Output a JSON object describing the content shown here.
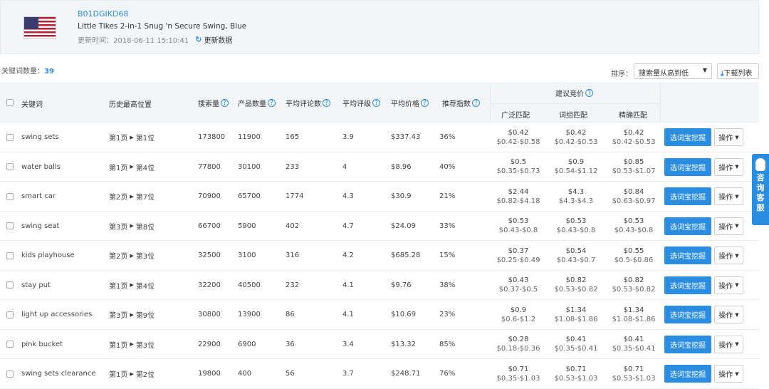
{
  "product": {
    "asin": "B01DGIKD68",
    "title": "Little Tikes 2-in-1 Snug 'n Secure Swing, Blue",
    "update_time": "更新时间：2018-06-11 15:10:41",
    "refresh_label": "更新数据"
  },
  "keyword_count": {
    "label": "关键词数量：",
    "value": "39"
  },
  "sort": {
    "label": "排序：",
    "selected": "搜索量从高到低"
  },
  "download_label": "下载列表",
  "columns": {
    "keyword": "关键词",
    "best_position": "历史最高位置",
    "search_volume": "搜索量",
    "product_count": "产品数量",
    "avg_reviews": "平均评论数",
    "avg_rating": "平均评级",
    "avg_price": "平均价格",
    "recommend": "推荐指数",
    "bid_group": "建议竞价",
    "broad": "广泛匹配",
    "phrase": "词组匹配",
    "exact": "精确匹配"
  },
  "rows": [
    {
      "keyword": "swing sets",
      "page": "第1页",
      "pos": "第1位",
      "search": "173800",
      "products": "11900",
      "reviews": "165",
      "rating": "3.9",
      "price": "$337.43",
      "rec": "36%",
      "broad": "$0.42",
      "broad_range": "$0.42-$0.58",
      "phrase": "$0.42",
      "phrase_range": "$0.42-$0.53",
      "exact": "$0.42",
      "exact_range": "$0.42-$0.53"
    },
    {
      "keyword": "water balls",
      "page": "第1页",
      "pos": "第4位",
      "search": "77800",
      "products": "30100",
      "reviews": "233",
      "rating": "4",
      "price": "$8.96",
      "rec": "40%",
      "broad": "$0.5",
      "broad_range": "$0.35-$0.73",
      "phrase": "$0.9",
      "phrase_range": "$0.54-$1.12",
      "exact": "$0.85",
      "exact_range": "$0.53-$1.07"
    },
    {
      "keyword": "smart car",
      "page": "第2页",
      "pos": "第7位",
      "search": "70900",
      "products": "65700",
      "reviews": "1774",
      "rating": "4.3",
      "price": "$30.9",
      "rec": "21%",
      "broad": "$2.44",
      "broad_range": "$0.82-$4.18",
      "phrase": "$4.3",
      "phrase_range": "$4.3-$4.3",
      "exact": "$0.84",
      "exact_range": "$0.63-$0.97"
    },
    {
      "keyword": "swing seat",
      "page": "第3页",
      "pos": "第8位",
      "search": "66700",
      "products": "5900",
      "reviews": "402",
      "rating": "4.7",
      "price": "$24.09",
      "rec": "33%",
      "broad": "$0.53",
      "broad_range": "$0.43-$0.8",
      "phrase": "$0.53",
      "phrase_range": "$0.43-$0.8",
      "exact": "$0.53",
      "exact_range": "$0.43-$0.8"
    },
    {
      "keyword": "kids playhouse",
      "page": "第2页",
      "pos": "第3位",
      "search": "32500",
      "products": "3100",
      "reviews": "316",
      "rating": "4.2",
      "price": "$685.28",
      "rec": "15%",
      "broad": "$0.37",
      "broad_range": "$0.25-$0.49",
      "phrase": "$0.54",
      "phrase_range": "$0.43-$0.7",
      "exact": "$0.55",
      "exact_range": "$0.5-$0.86"
    },
    {
      "keyword": "stay put",
      "page": "第1页",
      "pos": "第4位",
      "search": "32200",
      "products": "40500",
      "reviews": "232",
      "rating": "4.1",
      "price": "$9.76",
      "rec": "38%",
      "broad": "$0.43",
      "broad_range": "$0.37-$0.5",
      "phrase": "$0.82",
      "phrase_range": "$0.53-$0.82",
      "exact": "$0.82",
      "exact_range": "$0.53-$0.82"
    },
    {
      "keyword": "light up accessories",
      "page": "第3页",
      "pos": "第9位",
      "search": "30800",
      "products": "13900",
      "reviews": "86",
      "rating": "4.1",
      "price": "$10.69",
      "rec": "23%",
      "broad": "$0.9",
      "broad_range": "$0.6-$1.2",
      "phrase": "$1.34",
      "phrase_range": "$1.08-$1.86",
      "exact": "$1.34",
      "exact_range": "$1.08-$1.86"
    },
    {
      "keyword": "pink bucket",
      "page": "第1页",
      "pos": "第3位",
      "search": "22900",
      "products": "6900",
      "reviews": "36",
      "rating": "3.4",
      "price": "$13.32",
      "rec": "85%",
      "broad": "$0.28",
      "broad_range": "$0.18-$0.36",
      "phrase": "$0.41",
      "phrase_range": "$0.35-$0.41",
      "exact": "$0.41",
      "exact_range": "$0.35-$0.41"
    },
    {
      "keyword": "swing sets clearance",
      "page": "第1页",
      "pos": "第2位",
      "search": "19800",
      "products": "400",
      "reviews": "56",
      "rating": "3.7",
      "price": "$248.71",
      "rec": "76%",
      "broad": "$0.71",
      "broad_range": "$0.35-$1.03",
      "phrase": "$0.71",
      "phrase_range": "$0.53-$1.03",
      "exact": "$0.71",
      "exact_range": "$0.53-$1.03"
    }
  ],
  "row_actions": {
    "dig_label": "选词宝挖掘",
    "op_label": "操作"
  },
  "side_service": {
    "chars": [
      "咨",
      "询",
      "客",
      "服"
    ]
  },
  "colors": {
    "accent": "#2a8de0",
    "header_bg": "#f3f6f9"
  },
  "icons": {
    "refresh": "refresh-icon",
    "download": "download-icon",
    "help": "question-icon",
    "qq": "penguin-icon"
  }
}
